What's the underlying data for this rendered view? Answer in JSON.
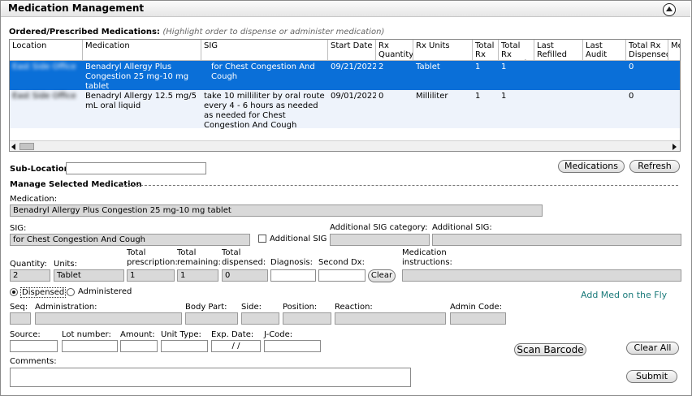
{
  "header": {
    "title": "Medication Management"
  },
  "ordered": {
    "label": "Ordered/Prescribed Medications:",
    "hint": "(Highlight order to dispense or administer medication)"
  },
  "grid": {
    "columns": [
      "Location",
      "Medication",
      "SIG",
      "Start Date",
      "Rx Quantity",
      "Rx Units",
      "Total Rx",
      "Total Rx Remain",
      "Last Refilled",
      "Last Audit",
      "Total Rx Dispensed",
      "Me"
    ],
    "rows": [
      {
        "location": "East Side Office",
        "medication": "Benadryl Allergy Plus Congestion 25 mg-10 mg tablet",
        "sig": "for Chest Congestion And Cough",
        "start_date": "09/21/2022",
        "rx_quantity": "2",
        "rx_units": "Tablet",
        "total_rx": "1",
        "total_rx_remain": "1",
        "last_refilled": "",
        "last_audit": "",
        "total_rx_dispensed": "0"
      },
      {
        "location": "East Side Office",
        "medication": "Benadryl Allergy 12.5 mg/5 mL oral liquid",
        "sig": "take 10 milliliter by oral route every 4 - 6 hours as needed as needed for Chest Congestion And Cough",
        "start_date": "09/01/2022",
        "rx_quantity": "0",
        "rx_units": "Milliliter",
        "total_rx": "1",
        "total_rx_remain": "1",
        "last_refilled": "",
        "last_audit": "",
        "total_rx_dispensed": "0"
      }
    ]
  },
  "sublocation": {
    "label": "Sub-Location:",
    "value": ""
  },
  "buttons": {
    "medications": "Medications",
    "refresh": "Refresh",
    "clear": "Clear",
    "scan_barcode": "Scan Barcode",
    "clear_all": "Clear All",
    "submit": "Submit"
  },
  "manage": {
    "section_label": "Manage Selected Medication",
    "medication_label": "Medication:",
    "medication_value": "Benadryl Allergy Plus Congestion 25 mg-10 mg tablet",
    "sig_label": "SIG:",
    "sig_value": "for Chest Congestion And Cough",
    "additional_sig_checkbox": "Additional SIG",
    "additional_sig_category_label": "Additional SIG category:",
    "additional_sig_label": "Additional SIG:",
    "quantity_label": "Quantity:",
    "quantity_value": "2",
    "units_label": "Units:",
    "units_value": "Tablet",
    "total_prescription_label1": "Total",
    "total_prescription_label2": "prescription:",
    "total_prescription_value": "1",
    "total_remaining_label1": "Total",
    "total_remaining_label2": "remaining:",
    "total_remaining_value": "1",
    "total_dispensed_label1": "Total",
    "total_dispensed_label2": "dispensed:",
    "total_dispensed_value": "0",
    "diagnosis_label": "Diagnosis:",
    "second_dx_label": "Second Dx:",
    "med_instructions_label1": "Medication",
    "med_instructions_label2": "instructions:",
    "dispensed_radio": "Dispensed",
    "administered_radio": "Administered",
    "add_med_link": "Add Med on the Fly",
    "seq_label": "Seq:",
    "administration_label": "Administration:",
    "body_part_label": "Body Part:",
    "side_label": "Side:",
    "position_label": "Position:",
    "reaction_label": "Reaction:",
    "admin_code_label": "Admin Code:",
    "source_label": "Source:",
    "lot_number_label": "Lot number:",
    "amount_label": "Amount:",
    "unit_type_label": "Unit Type:",
    "exp_date_label": "Exp. Date:",
    "exp_date_value": " / /",
    "jcode_label": "J-Code:",
    "comments_label": "Comments:"
  }
}
